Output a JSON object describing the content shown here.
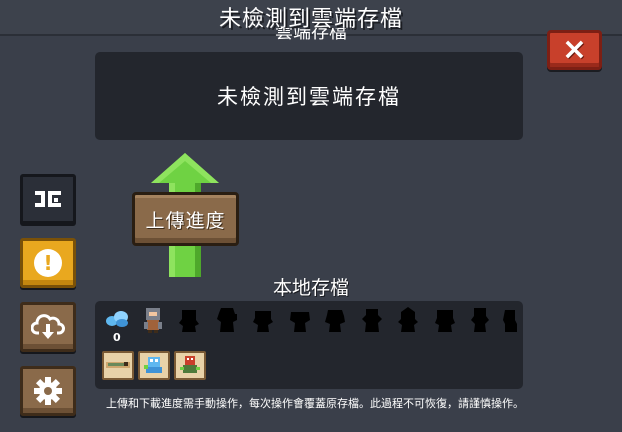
{
  "header": {
    "title": "未檢測到雲端存檔"
  },
  "cloud_section": {
    "label": "雲端存檔",
    "status_text": "未檢測到雲端存檔"
  },
  "close_button": {
    "icon": "close-icon",
    "label": "×"
  },
  "sidebar": {
    "items": [
      {
        "name": "sync",
        "glyph": "⭆"
      },
      {
        "name": "alert",
        "glyph": "!"
      },
      {
        "name": "cloud-download",
        "glyph": ""
      },
      {
        "name": "settings",
        "glyph": ""
      }
    ]
  },
  "upload": {
    "label": "上傳進度"
  },
  "local_section": {
    "heading": "本地存檔",
    "gem_count": "0"
  },
  "footer": {
    "note": "上傳和下載進度需手動操作，每次操作會覆蓋原存檔。此過程不可恢復，請謹慎操作。"
  },
  "colors": {
    "background": "#3a3f4a",
    "panel": "#23262d",
    "close_red": "#c8402b",
    "gold": "#e9a81f",
    "wood_brown": "#8a6a4a",
    "arrow_green": "#6fd243"
  }
}
